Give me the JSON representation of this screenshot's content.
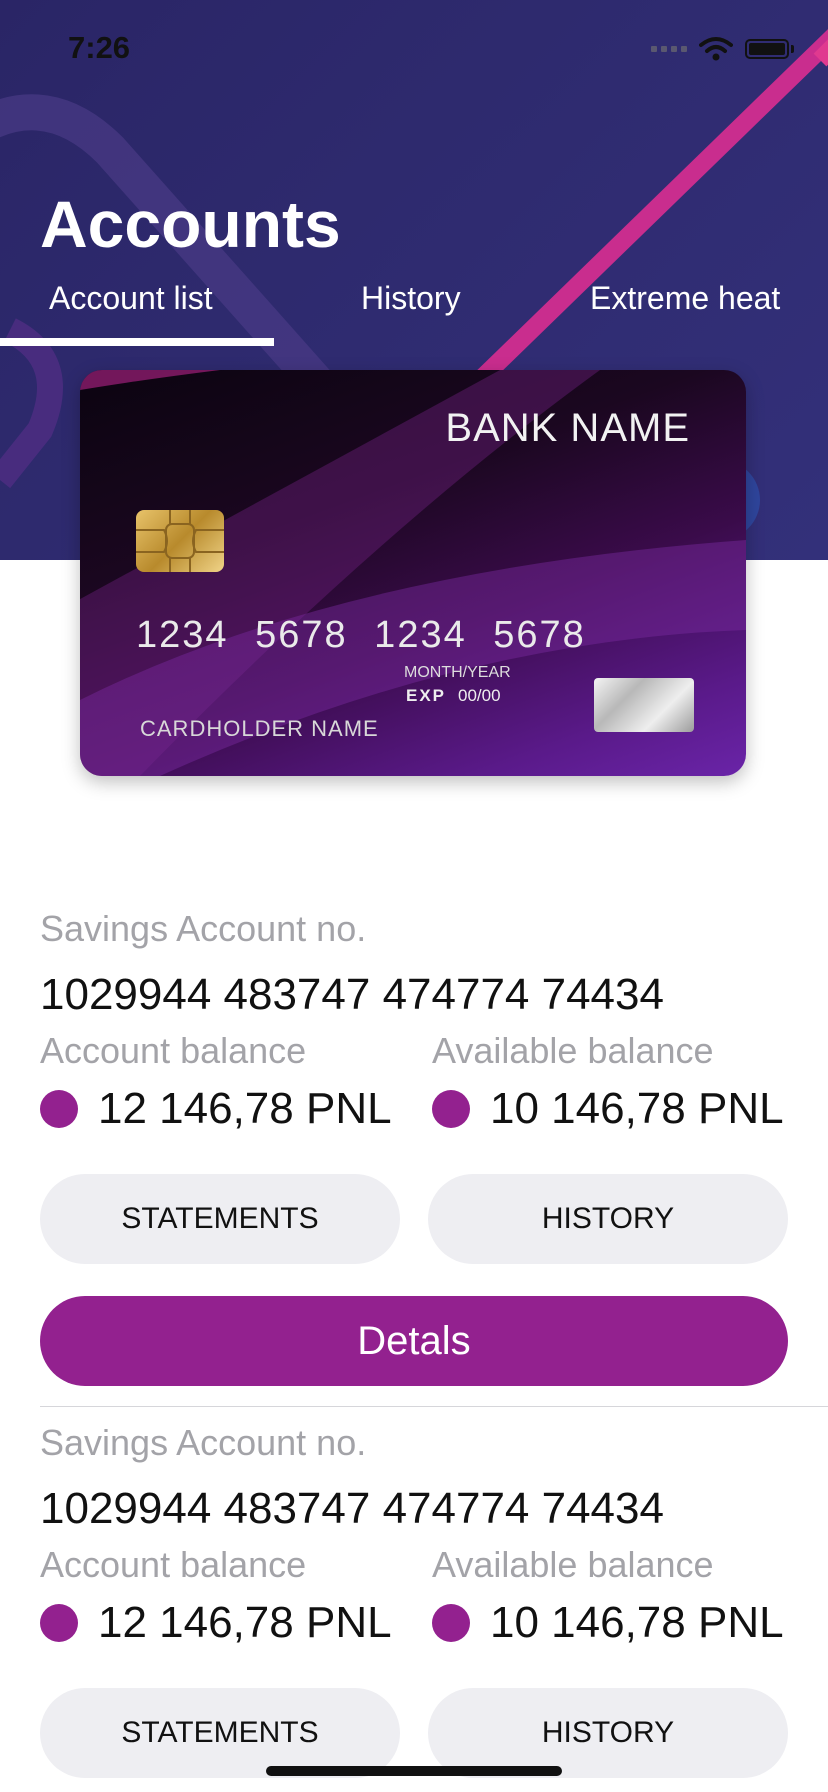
{
  "status_bar": {
    "time": "7:26"
  },
  "header": {
    "title": "Accounts",
    "tabs": [
      {
        "label": "Account list",
        "active": true
      },
      {
        "label": "History",
        "active": false
      },
      {
        "label": "Extreme heat",
        "active": false
      }
    ]
  },
  "card": {
    "bank_name": "BANK NAME",
    "number": "1234 5678 1234 5678",
    "month_year_label": "MONTH/YEAR",
    "exp_label": "EXP",
    "exp_value": "00/00",
    "holder": "CARDHOLDER NAME"
  },
  "accounts": [
    {
      "type_label": "Savings Account no.",
      "number": "1029944 483747 474774 74434",
      "account_balance_label": "Account balance",
      "account_balance": "12 146,78 PNL",
      "available_balance_label": "Available balance",
      "available_balance": "10 146,78 PNL",
      "statements_label": "STATEMENTS",
      "history_label": "HISTORY",
      "details_label": "Detals"
    },
    {
      "type_label": "Savings Account no.",
      "number": "1029944 483747 474774 74434",
      "account_balance_label": "Account balance",
      "account_balance": "12 146,78 PNL",
      "available_balance_label": "Available balance",
      "available_balance": "10 146,78 PNL",
      "statements_label": "STATEMENTS",
      "history_label": "HISTORY"
    }
  ],
  "colors": {
    "header_bg": "#2e2a6e",
    "accent": "#93218f",
    "button_grey": "#eeeef2",
    "muted_text": "#a3a3a8"
  },
  "icons": [
    "cellular-signal-icon",
    "wifi-icon",
    "battery-icon",
    "card-chip-icon",
    "hologram-icon"
  ]
}
